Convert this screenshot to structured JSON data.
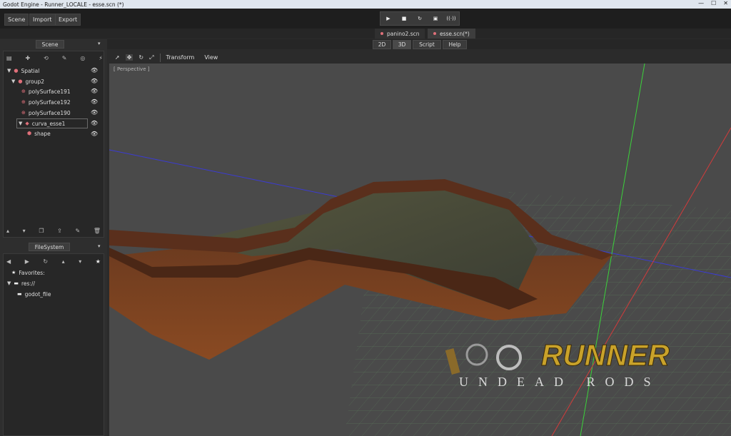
{
  "window": {
    "title": "Godot Engine - Runner_LOCALE - esse.scn (*)",
    "controls": [
      "—",
      "☐",
      "✕"
    ]
  },
  "menu": {
    "items": [
      "Scene",
      "Import",
      "Export"
    ]
  },
  "play": {
    "play": "▶",
    "pause": "■",
    "restart": "↻",
    "scene": "▣",
    "remote": "((·))"
  },
  "scene_tabs": [
    {
      "label": "panino2.scn"
    },
    {
      "label": "esse.scn(*)"
    }
  ],
  "mode_tabs": [
    "2D",
    "3D",
    "Script",
    "Help"
  ],
  "scene_dock": {
    "title": "Scene",
    "tree": [
      {
        "label": "Spatial",
        "icon": "spatial-icon"
      },
      {
        "label": "group2",
        "icon": "spatial-icon"
      },
      {
        "label": "polySurface191",
        "icon": "mesh-icon"
      },
      {
        "label": "polySurface192",
        "icon": "mesh-icon"
      },
      {
        "label": "polySurface190",
        "icon": "mesh-icon"
      },
      {
        "label": "curva_esse1",
        "icon": "staticbody-icon"
      },
      {
        "label": "shape",
        "icon": "collision-icon"
      }
    ]
  },
  "filesystem": {
    "title": "FileSystem",
    "favorites": "Favorites:",
    "root": "res://",
    "folder": "godot_file"
  },
  "viewport": {
    "tools": [
      "Transform",
      "View"
    ],
    "perspective_label": "[ Perspective ]",
    "logo_title": "RUNNER",
    "logo_subtitle": "UNDEAD RODS"
  },
  "colors": {
    "accent": "#e0707a",
    "axis_x": "#d23b3b",
    "axis_y": "#3bd23b",
    "axis_z": "#3b3bd2"
  }
}
